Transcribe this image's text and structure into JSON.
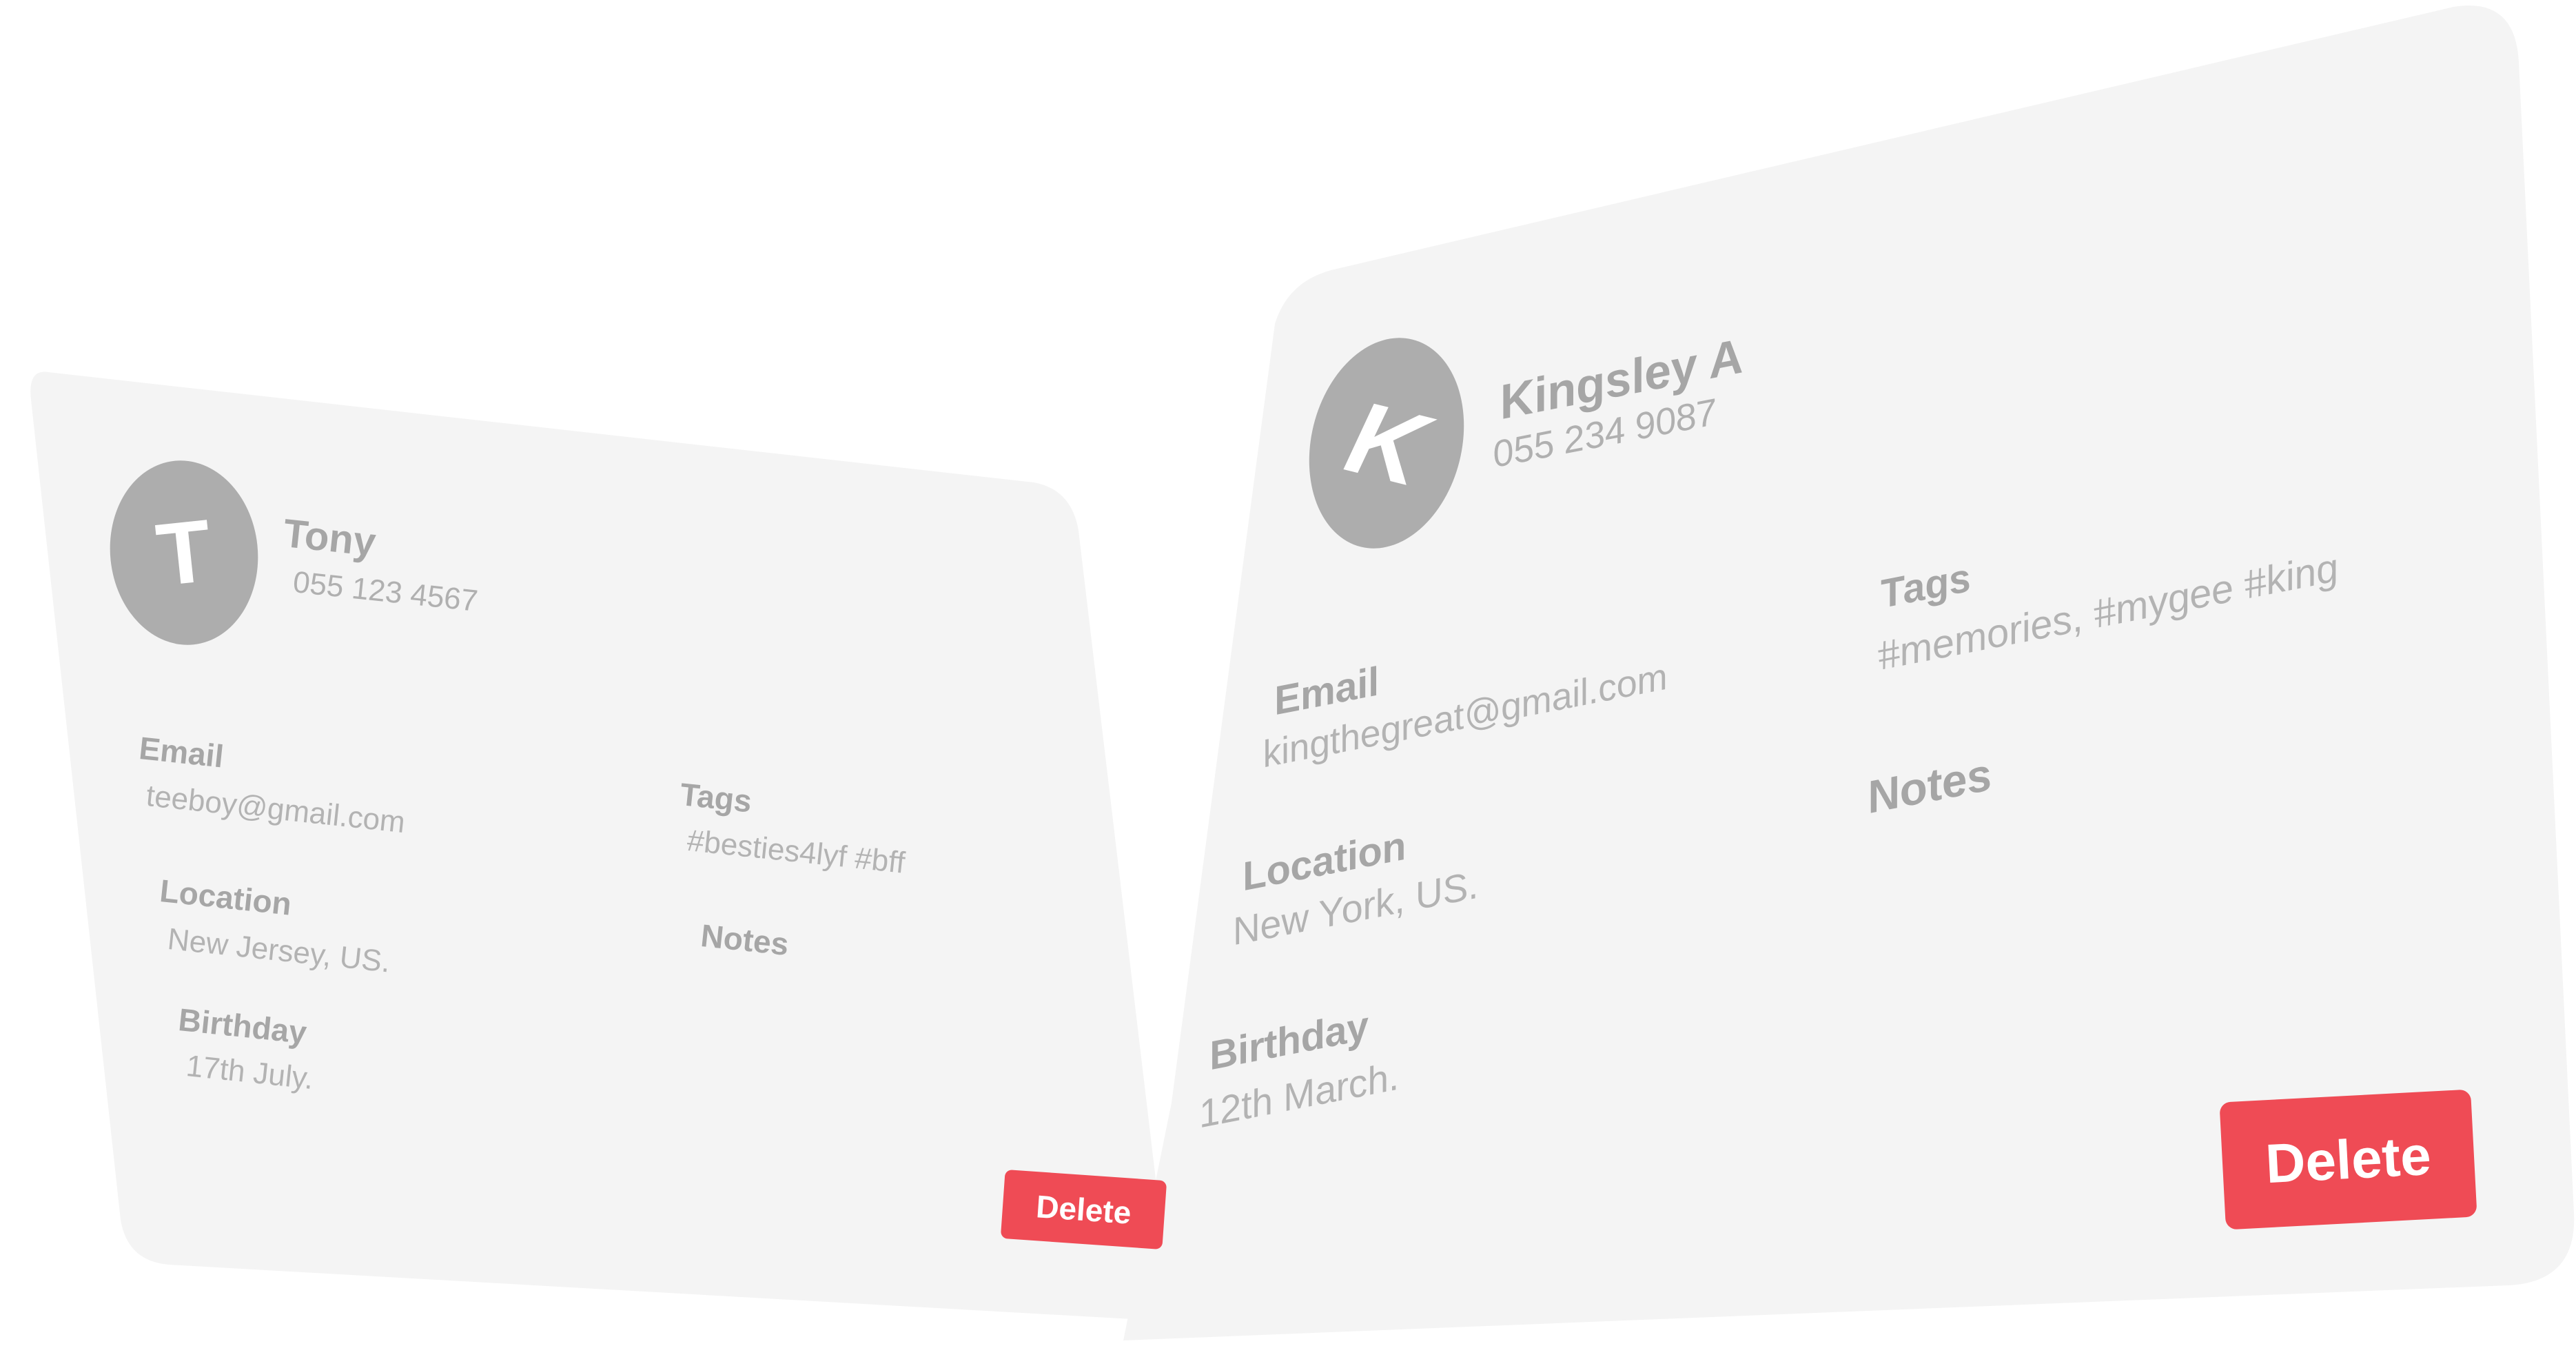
{
  "contacts": [
    {
      "initial": "T",
      "name": "Tony",
      "phone": "055 123 4567",
      "email_label": "Email",
      "email": "teeboy@gmail.com",
      "location_label": "Location",
      "location": "New Jersey, US.",
      "birthday_label": "Birthday",
      "birthday": "17th July.",
      "tags_label": "Tags",
      "tags": "#besties4lyf #bff",
      "notes_label": "Notes",
      "delete_label": "Delete"
    },
    {
      "initial": "K",
      "name": "Kingsley A",
      "phone": "055 234 9087",
      "email_label": "Email",
      "email": "kingthegreat@gmail.com",
      "location_label": "Location",
      "location": "New York, US.",
      "birthday_label": "Birthday",
      "birthday": "12th March.",
      "tags_label": "Tags",
      "tags": "#memories, #mygee #king",
      "notes_label": "Notes",
      "delete_label": "Delete"
    }
  ],
  "colors": {
    "card_bg": "#f4f4f4",
    "avatar_bg": "#adadad",
    "text": "#a9a9a9",
    "delete_bg": "#ef4b55"
  }
}
